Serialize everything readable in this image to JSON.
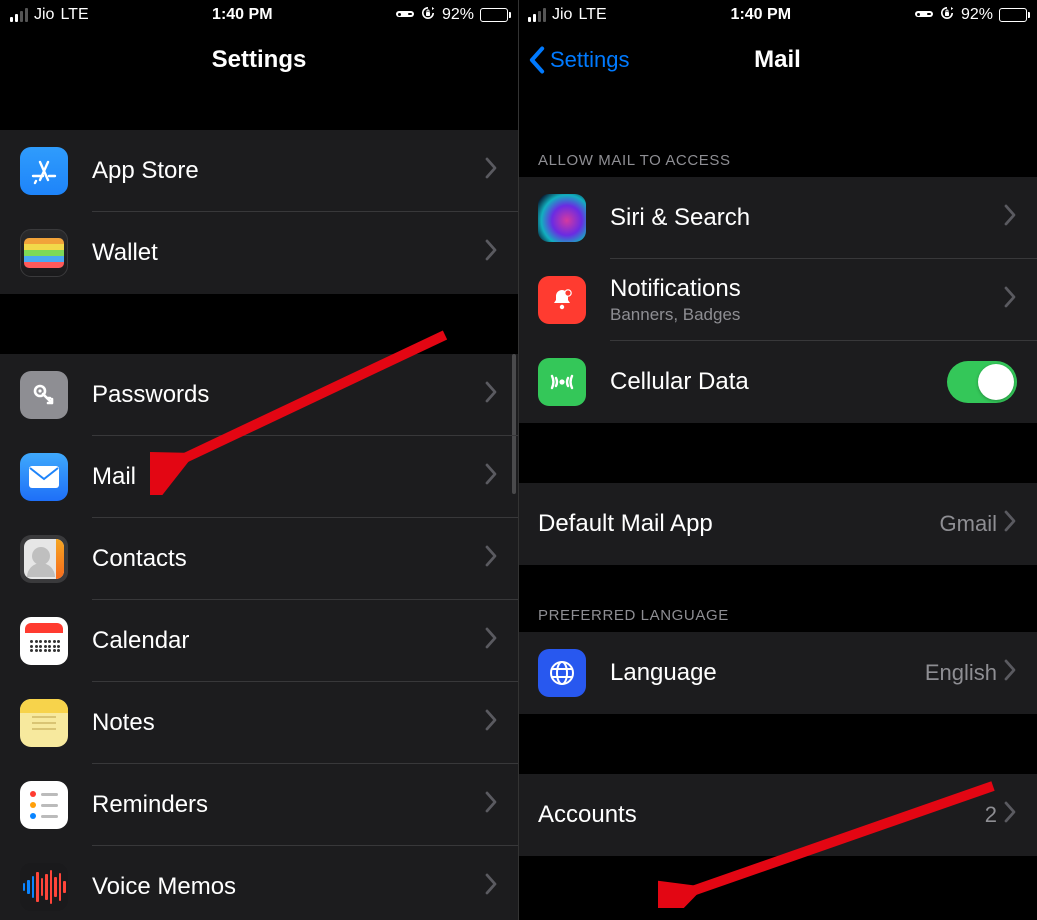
{
  "status": {
    "carrier": "Jio",
    "network": "LTE",
    "time": "1:40 PM",
    "battery_pct": "92%"
  },
  "left": {
    "title": "Settings",
    "rows": {
      "app_store": "App Store",
      "wallet": "Wallet",
      "passwords": "Passwords",
      "mail": "Mail",
      "contacts": "Contacts",
      "calendar": "Calendar",
      "notes": "Notes",
      "reminders": "Reminders",
      "voice_memos": "Voice Memos"
    }
  },
  "right": {
    "back": "Settings",
    "title": "Mail",
    "sections": {
      "allow_access": "ALLOW MAIL TO ACCESS",
      "preferred_language": "PREFERRED LANGUAGE"
    },
    "rows": {
      "siri": "Siri & Search",
      "notifications": "Notifications",
      "notifications_sub": "Banners, Badges",
      "cellular": "Cellular Data",
      "default_app": "Default Mail App",
      "default_app_value": "Gmail",
      "language": "Language",
      "language_value": "English",
      "accounts": "Accounts",
      "accounts_value": "2"
    }
  }
}
